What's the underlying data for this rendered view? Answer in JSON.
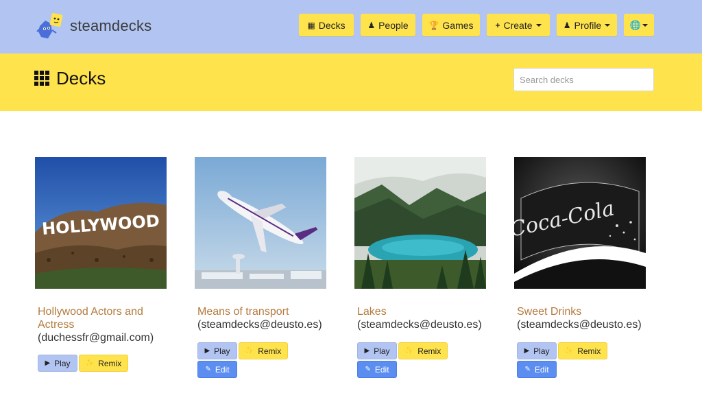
{
  "brand": {
    "name": "steamdecks"
  },
  "nav": {
    "decks": "Decks",
    "people": "People",
    "games": "Games",
    "create": "Create",
    "profile": "Profile"
  },
  "header": {
    "title": "Decks",
    "search_placeholder": "Search decks"
  },
  "buttons": {
    "play": "Play",
    "remix": "Remix",
    "edit": "Edit"
  },
  "decks": [
    {
      "title": "Hollywood Actors and Actress",
      "author": "(duchessfr@gmail.com)",
      "image": "hollywood-sign",
      "editable": false
    },
    {
      "title": "Means of transport",
      "author": "(steamdecks@deusto.es)",
      "image": "airplane-takeoff",
      "editable": true
    },
    {
      "title": "Lakes",
      "author": "(steamdecks@deusto.es)",
      "image": "mountain-lake",
      "editable": true
    },
    {
      "title": "Sweet Drinks",
      "author": "(steamdecks@deusto.es)",
      "image": "coca-cola-logo",
      "editable": true
    }
  ],
  "colors": {
    "navbar": "#b1c4f2",
    "accent": "#ffe34d",
    "title_link": "#b47a3e",
    "edit_button": "#5b8ef0"
  }
}
